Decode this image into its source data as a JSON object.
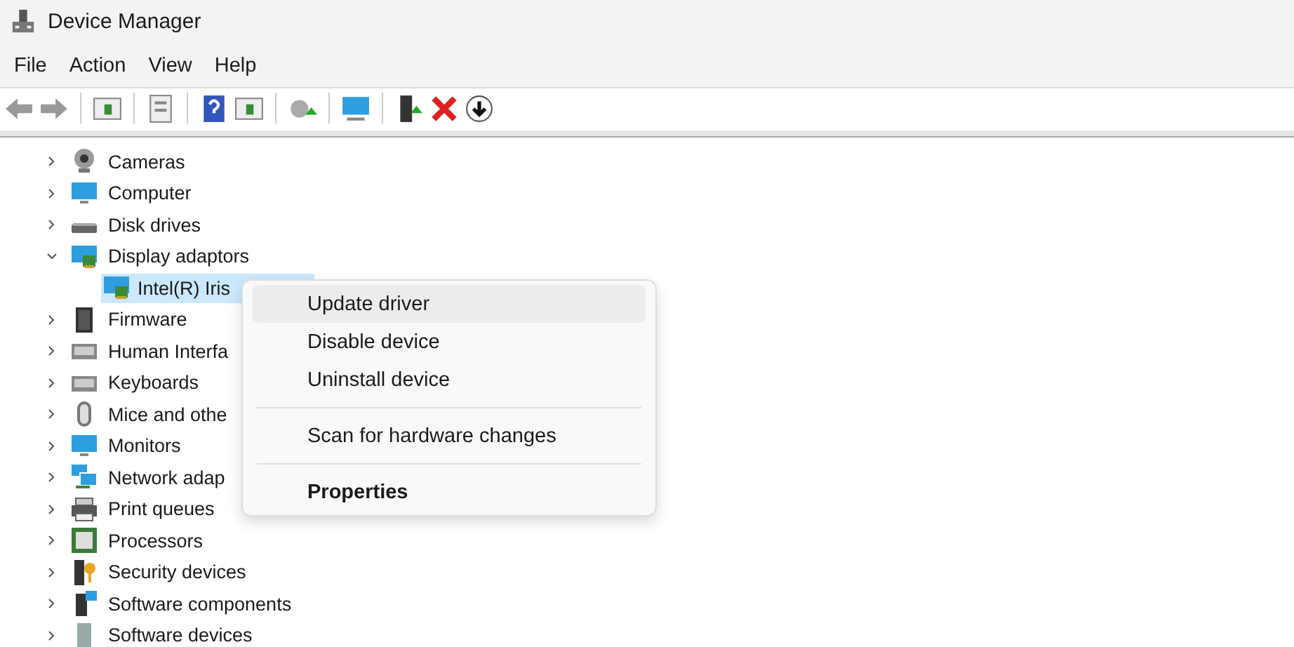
{
  "window": {
    "title": "Device Manager"
  },
  "menu_bar": [
    "File",
    "Action",
    "View",
    "Help"
  ],
  "tree": [
    {
      "label": "Cameras",
      "expanded": false
    },
    {
      "label": "Computer",
      "expanded": false
    },
    {
      "label": "Disk drives",
      "expanded": false
    },
    {
      "label": "Display adaptors",
      "expanded": true,
      "children": [
        {
          "label": "Intel(R) Iris",
          "selected": true
        }
      ]
    },
    {
      "label": "Firmware",
      "expanded": false
    },
    {
      "label": "Human Interfa",
      "expanded": false
    },
    {
      "label": "Keyboards",
      "expanded": false
    },
    {
      "label": "Mice and othe",
      "expanded": false
    },
    {
      "label": "Monitors",
      "expanded": false
    },
    {
      "label": "Network adap",
      "expanded": false
    },
    {
      "label": "Print queues",
      "expanded": false
    },
    {
      "label": "Processors",
      "expanded": false
    },
    {
      "label": "Security devices",
      "expanded": false
    },
    {
      "label": "Software components",
      "expanded": false
    },
    {
      "label": "Software devices",
      "expanded": false
    }
  ],
  "context_menu": [
    {
      "kind": "item",
      "label": "Update driver",
      "selected": true
    },
    {
      "kind": "item",
      "label": "Disable device",
      "selected": false
    },
    {
      "kind": "item",
      "label": "Uninstall device",
      "selected": false
    },
    {
      "kind": "separator"
    },
    {
      "kind": "item",
      "label": "Scan for hardware changes",
      "selected": false
    },
    {
      "kind": "separator"
    },
    {
      "kind": "default",
      "label": "Properties",
      "selected": false
    }
  ]
}
